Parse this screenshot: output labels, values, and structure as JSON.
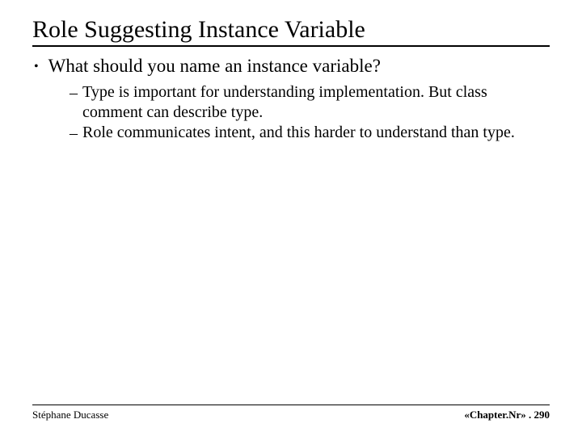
{
  "title": "Role Suggesting Instance Variable",
  "bullets": {
    "main": "What should you name an instance variable?",
    "sub1": "Type is important for understanding implementation.  But class comment can describe type.",
    "sub2": "Role communicates intent, and this harder to understand than type."
  },
  "footer": {
    "left": "Stéphane Ducasse",
    "right": "«Chapter.Nr» . 290"
  }
}
